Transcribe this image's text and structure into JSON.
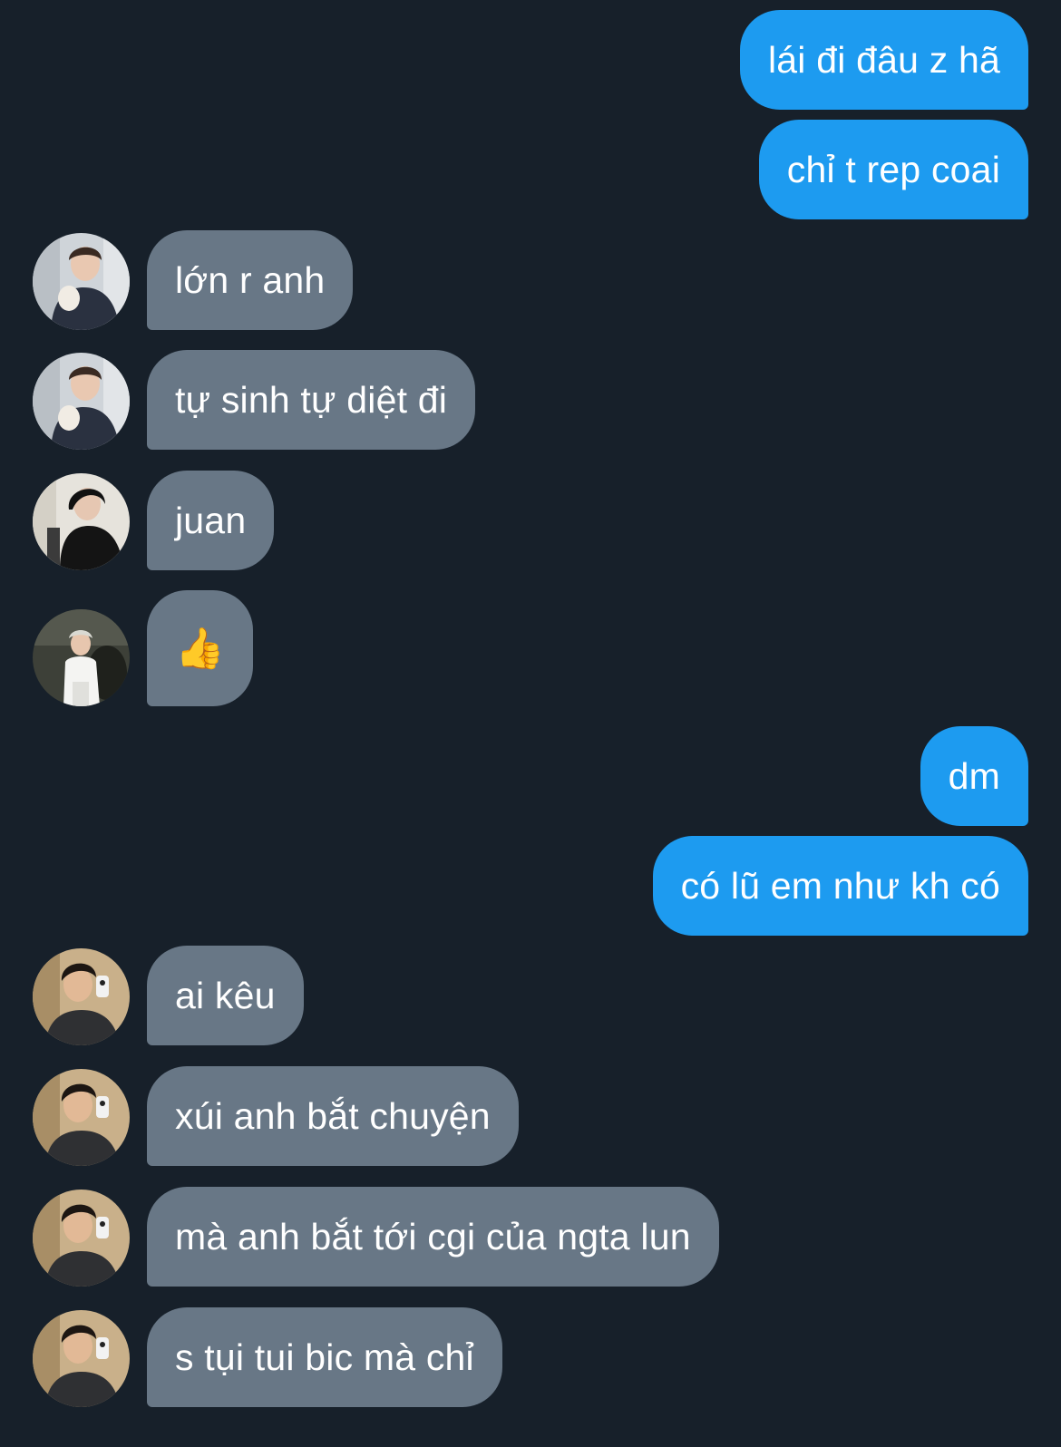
{
  "colors": {
    "background": "#17202a",
    "outgoing_bubble": "#1d9bf0",
    "incoming_bubble": "#687786",
    "text": "#ffffff"
  },
  "messages": [
    {
      "direction": "outgoing",
      "text": "lái đi đâu z hã"
    },
    {
      "direction": "outgoing",
      "text": "chỉ t rep coai"
    },
    {
      "direction": "incoming",
      "avatar": "avatar-user-a",
      "text": "lớn r anh"
    },
    {
      "direction": "incoming",
      "avatar": "avatar-user-a",
      "text": "tự sinh tự diệt đi"
    },
    {
      "direction": "incoming",
      "avatar": "avatar-user-b",
      "text": "juan"
    },
    {
      "direction": "incoming",
      "avatar": "avatar-user-c",
      "text": "👍",
      "icon": "thumbs-up-icon"
    },
    {
      "direction": "outgoing",
      "text": "dm"
    },
    {
      "direction": "outgoing",
      "text": "có lũ em như kh có"
    },
    {
      "direction": "incoming",
      "avatar": "avatar-user-d",
      "text": "ai kêu"
    },
    {
      "direction": "incoming",
      "avatar": "avatar-user-d",
      "text": "xúi anh bắt chuyện"
    },
    {
      "direction": "incoming",
      "avatar": "avatar-user-d",
      "text": "mà anh bắt tới cgi của ngta lun"
    },
    {
      "direction": "incoming",
      "avatar": "avatar-user-d",
      "text": "s tụi tui bic mà chỉ"
    }
  ]
}
